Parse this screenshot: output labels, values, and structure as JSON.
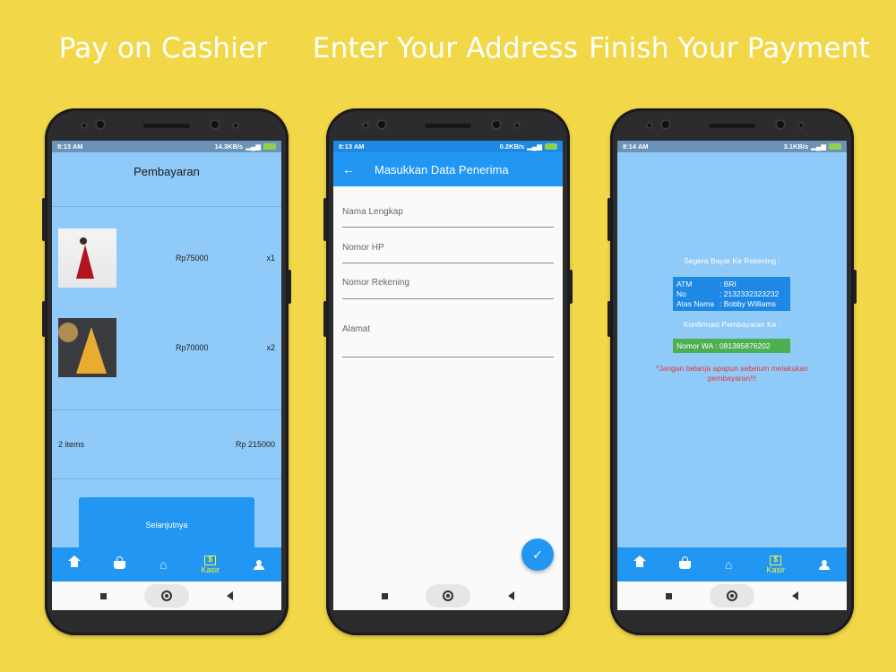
{
  "captions": [
    "Pay on Cashier",
    "Enter Your Address",
    "Finish Your Payment"
  ],
  "status": [
    {
      "time": "8:13 AM",
      "speed": "14.3KB/s"
    },
    {
      "time": "8:13 AM",
      "speed": "0.2KB/s"
    },
    {
      "time": "8:14 AM",
      "speed": "3.1KB/s"
    }
  ],
  "screen1": {
    "title": "Pembayaran",
    "items": [
      {
        "price": "Rp75000",
        "qty": "x1"
      },
      {
        "price": "Rp70000",
        "qty": "x2"
      }
    ],
    "summary_count": "2 items",
    "summary_total": "Rp 215000",
    "next_label": "Selanjutnya"
  },
  "screen2": {
    "title": "Masukkan Data Penerima",
    "fields": [
      "Nama Lengkap",
      "Nomor HP",
      "Nomor Rekening",
      "Alamat"
    ]
  },
  "screen3": {
    "pay_prompt": "Segera Bayar Ke Rekening :",
    "bank": {
      "atm_key": "ATM",
      "atm_val": ": BRI",
      "no_key": "No",
      "no_val": ": 2132332323232",
      "name_key": "Atas Nama",
      "name_val": ": Bobby Williams"
    },
    "confirm_prompt": "Konfirmasi Pembayaran Ke :",
    "wa": "Nomor WA : 081385876202",
    "warning": "*Jangan belanja apapun sebelum melakukan pembayaran!!!"
  },
  "tabs": {
    "kasir": "Kasir"
  },
  "colors": {
    "background": "#f2d848",
    "primary": "#2196f3",
    "light": "#90caf9",
    "active_tab": "#f5ee3b",
    "wa": "#4caf50",
    "warning": "#e53935"
  }
}
